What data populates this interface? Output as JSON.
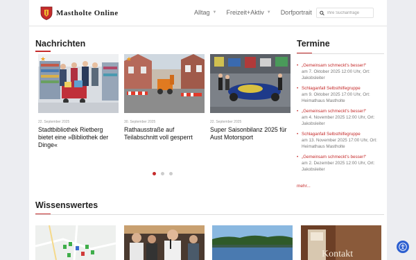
{
  "header": {
    "logo_text": "Mastholte Online",
    "nav": [
      {
        "label": "Alltag",
        "has_dropdown": true
      },
      {
        "label": "Freizeit+Aktiv",
        "has_dropdown": true
      },
      {
        "label": "Dorfportrait",
        "has_dropdown": false
      }
    ],
    "search_placeholder": "Ihre Suchanfrage"
  },
  "news": {
    "heading": "Nachrichten",
    "items": [
      {
        "date": "22. September 2025",
        "title": "Stadtbibliothek Rietberg bietet eine »Bibliothek der Dinge«",
        "featured": true
      },
      {
        "date": "30. September 2025",
        "title": "Rathausstraße auf Teilabschnitt voll gesperrt",
        "featured": true
      },
      {
        "date": "22. September 2025",
        "title": "Super Saisonbilanz 2025 für Aust Motorsport",
        "featured": false
      }
    ],
    "slider_dots": 3,
    "active_dot": 1
  },
  "termine": {
    "heading": "Termine",
    "items": [
      {
        "title": "„Gemeinsam schmeckt's besser!“",
        "details": "am 7. Oktober 2025 12:00 Uhr, Ort: Jakobsleiter"
      },
      {
        "title": "Schlaganfall Selbsthilfegruppe",
        "details": "am 9. Oktober 2025 17:00 Uhr, Ort: Heimathaus Mastholte"
      },
      {
        "title": "„Gemeinsam schmeckt's besser!“",
        "details": "am 4. November 2025 12:00 Uhr, Ort: Jakobsleiter"
      },
      {
        "title": "Schlaganfall Selbsthilfegruppe",
        "details": "am 13. November 2025 17:00 Uhr, Ort: Heimathaus Mastholte"
      },
      {
        "title": "„Gemeinsam schmeckt's besser!“",
        "details": "am 2. Dezember 2025 12:00 Uhr, Ort: Jakobsleiter"
      }
    ],
    "more": "mehr..."
  },
  "wissenswertes": {
    "heading": "Wissenswertes",
    "tiles": [
      {
        "name": "map"
      },
      {
        "name": "people"
      },
      {
        "name": "lake"
      },
      {
        "name": "contact",
        "caption": "Kontakt"
      }
    ]
  },
  "colors": {
    "accent": "#c52b2b",
    "accessibility": "#2c5fd0"
  },
  "icons": [
    "crest-icon",
    "search-icon",
    "star-icon",
    "accessibility-icon"
  ]
}
